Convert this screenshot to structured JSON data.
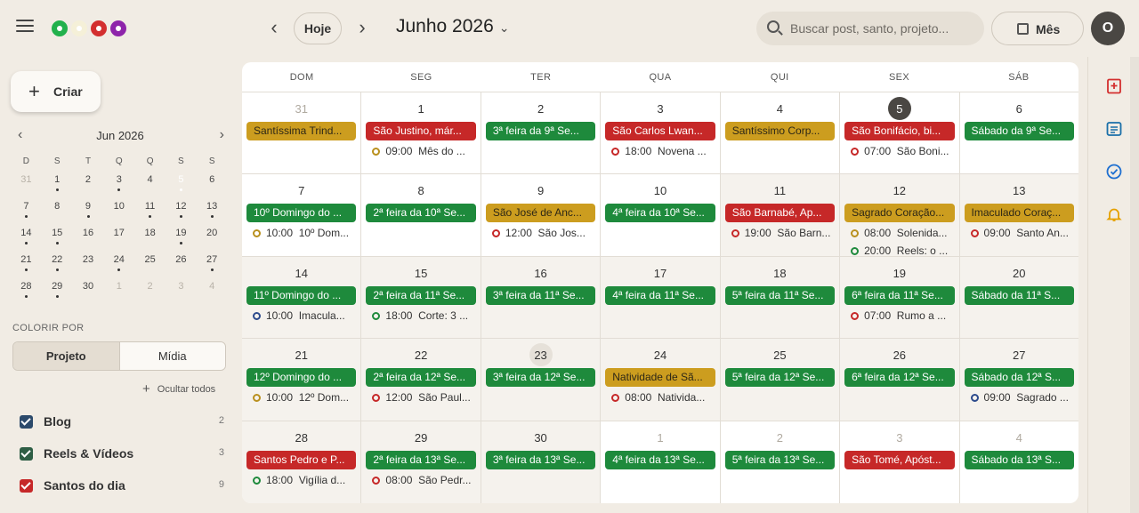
{
  "header": {
    "today_label": "Hoje",
    "month_label": "Junho 2026",
    "search_placeholder": "Buscar post, santo, projeto...",
    "view_label": "Mês",
    "avatar_initial": "O",
    "color_dots": [
      "#22b14c",
      "#f5f0d8",
      "#d32f2f",
      "#8e24aa"
    ]
  },
  "sidebar": {
    "create_label": "Criar",
    "mini_calendar": {
      "title": "Jun 2026",
      "weekdays": [
        "D",
        "S",
        "T",
        "Q",
        "Q",
        "S",
        "S"
      ],
      "weeks": [
        [
          {
            "d": "31",
            "out": true
          },
          {
            "d": "1",
            "dot": true
          },
          {
            "d": "2"
          },
          {
            "d": "3",
            "dot": true
          },
          {
            "d": "4"
          },
          {
            "d": "5",
            "sel": true,
            "dot": true
          },
          {
            "d": "6"
          }
        ],
        [
          {
            "d": "7",
            "dot": true
          },
          {
            "d": "8"
          },
          {
            "d": "9",
            "dot": true
          },
          {
            "d": "10"
          },
          {
            "d": "11",
            "dot": true
          },
          {
            "d": "12",
            "dot": true
          },
          {
            "d": "13",
            "dot": true
          }
        ],
        [
          {
            "d": "14",
            "dot": true
          },
          {
            "d": "15",
            "dot": true
          },
          {
            "d": "16"
          },
          {
            "d": "17"
          },
          {
            "d": "18"
          },
          {
            "d": "19",
            "dot": true
          },
          {
            "d": "20"
          }
        ],
        [
          {
            "d": "21",
            "dot": true
          },
          {
            "d": "22",
            "dot": true
          },
          {
            "d": "23"
          },
          {
            "d": "24",
            "dot": true
          },
          {
            "d": "25"
          },
          {
            "d": "26"
          },
          {
            "d": "27",
            "dot": true
          }
        ],
        [
          {
            "d": "28",
            "dot": true
          },
          {
            "d": "29",
            "dot": true
          },
          {
            "d": "30"
          },
          {
            "d": "1",
            "out": true
          },
          {
            "d": "2",
            "out": true
          },
          {
            "d": "3",
            "out": true
          },
          {
            "d": "4",
            "out": true
          }
        ]
      ]
    },
    "colorir_label": "COLORIR POR",
    "toggle": {
      "projeto": "Projeto",
      "midia": "Mídia"
    },
    "hide_all_label": "Ocultar todos",
    "projects": [
      {
        "name": "Blog",
        "count": "2",
        "color": "#2c4a6b"
      },
      {
        "name": "Reels & Vídeos",
        "count": "3",
        "color": "#2e5e45"
      },
      {
        "name": "Santos do dia",
        "count": "9",
        "color": "#c62828"
      }
    ]
  },
  "calendar": {
    "weekdays": [
      "DOM",
      "SEG",
      "TER",
      "QUA",
      "QUI",
      "SEX",
      "SÁB"
    ],
    "weeks": [
      [
        {
          "d": "31",
          "out": true,
          "past": false,
          "events": [
            {
              "t": "Santíssima Trind...",
              "c": "gold"
            }
          ]
        },
        {
          "d": "1",
          "events": [
            {
              "t": "São Justino, már...",
              "c": "red"
            }
          ],
          "times": [
            {
              "t": "09:00  Mês do ...",
              "c": "gold"
            }
          ]
        },
        {
          "d": "2",
          "events": [
            {
              "t": "3ª feira da 9ª Se...",
              "c": "green"
            }
          ]
        },
        {
          "d": "3",
          "events": [
            {
              "t": "São Carlos Lwan...",
              "c": "red"
            }
          ],
          "times": [
            {
              "t": "18:00  Novena ...",
              "c": "red"
            }
          ]
        },
        {
          "d": "4",
          "events": [
            {
              "t": "Santíssimo Corp...",
              "c": "gold"
            }
          ]
        },
        {
          "d": "5",
          "today": true,
          "events": [
            {
              "t": "São Bonifácio, bi...",
              "c": "red"
            }
          ],
          "times": [
            {
              "t": "07:00  São Boni...",
              "c": "red"
            }
          ]
        },
        {
          "d": "6",
          "events": [
            {
              "t": "Sábado da 9ª Se...",
              "c": "green"
            }
          ]
        }
      ],
      [
        {
          "d": "7",
          "events": [
            {
              "t": "10º Domingo do ...",
              "c": "green"
            }
          ],
          "times": [
            {
              "t": "10:00  10º Dom...",
              "c": "gold"
            }
          ]
        },
        {
          "d": "8",
          "events": [
            {
              "t": "2ª feira da 10ª Se...",
              "c": "green"
            }
          ]
        },
        {
          "d": "9",
          "events": [
            {
              "t": "São José de Anc...",
              "c": "gold"
            }
          ],
          "times": [
            {
              "t": "12:00  São Jos...",
              "c": "red"
            }
          ]
        },
        {
          "d": "10",
          "events": [
            {
              "t": "4ª feira da 10ª Se...",
              "c": "green"
            }
          ]
        },
        {
          "d": "11",
          "past": true,
          "events": [
            {
              "t": "São Barnabé, Ap...",
              "c": "red"
            }
          ],
          "times": [
            {
              "t": "19:00  São Barn...",
              "c": "red"
            }
          ]
        },
        {
          "d": "12",
          "past": true,
          "events": [
            {
              "t": "Sagrado Coração...",
              "c": "gold"
            }
          ],
          "times": [
            {
              "t": "08:00  Solenida...",
              "c": "gold"
            },
            {
              "t": "20:00  Reels: o ...",
              "c": "green"
            }
          ]
        },
        {
          "d": "13",
          "past": true,
          "events": [
            {
              "t": "Imaculado Coraç...",
              "c": "gold"
            }
          ],
          "times": [
            {
              "t": "09:00  Santo An...",
              "c": "red"
            }
          ]
        }
      ],
      [
        {
          "d": "14",
          "past": true,
          "events": [
            {
              "t": "11º Domingo do ...",
              "c": "green"
            }
          ],
          "times": [
            {
              "t": "10:00  Imacula...",
              "c": "blue"
            }
          ]
        },
        {
          "d": "15",
          "past": true,
          "events": [
            {
              "t": "2ª feira da 11ª Se...",
              "c": "green"
            }
          ],
          "times": [
            {
              "t": "18:00  Corte: 3 ...",
              "c": "green"
            }
          ]
        },
        {
          "d": "16",
          "past": true,
          "events": [
            {
              "t": "3ª feira da 11ª Se...",
              "c": "green"
            }
          ]
        },
        {
          "d": "17",
          "past": true,
          "events": [
            {
              "t": "4ª feira da 11ª Se...",
              "c": "green"
            }
          ]
        },
        {
          "d": "18",
          "past": true,
          "events": [
            {
              "t": "5ª feira da 11ª Se...",
              "c": "green"
            }
          ]
        },
        {
          "d": "19",
          "past": true,
          "events": [
            {
              "t": "6ª feira da 11ª Se...",
              "c": "green"
            }
          ],
          "times": [
            {
              "t": "07:00  Rumo a ...",
              "c": "red"
            }
          ]
        },
        {
          "d": "20",
          "past": true,
          "events": [
            {
              "t": "Sábado da 11ª S...",
              "c": "green"
            }
          ]
        }
      ],
      [
        {
          "d": "21",
          "past": true,
          "events": [
            {
              "t": "12º Domingo do ...",
              "c": "green"
            }
          ],
          "times": [
            {
              "t": "10:00  12º Dom...",
              "c": "gold"
            }
          ]
        },
        {
          "d": "22",
          "past": true,
          "events": [
            {
              "t": "2ª feira da 12ª Se...",
              "c": "green"
            }
          ],
          "times": [
            {
              "t": "12:00  São Paul...",
              "c": "red"
            }
          ]
        },
        {
          "d": "23",
          "past": true,
          "hl": true,
          "events": [
            {
              "t": "3ª feira da 12ª Se...",
              "c": "green"
            }
          ]
        },
        {
          "d": "24",
          "past": true,
          "events": [
            {
              "t": "Natividade de Sã...",
              "c": "gold"
            }
          ],
          "times": [
            {
              "t": "08:00  Nativida...",
              "c": "red"
            }
          ]
        },
        {
          "d": "25",
          "past": true,
          "events": [
            {
              "t": "5ª feira da 12ª Se...",
              "c": "green"
            }
          ]
        },
        {
          "d": "26",
          "past": true,
          "events": [
            {
              "t": "6ª feira da 12ª Se...",
              "c": "green"
            }
          ]
        },
        {
          "d": "27",
          "past": true,
          "events": [
            {
              "t": "Sábado da 12ª S...",
              "c": "green"
            }
          ],
          "times": [
            {
              "t": "09:00  Sagrado ...",
              "c": "blue"
            }
          ]
        }
      ],
      [
        {
          "d": "28",
          "past": true,
          "events": [
            {
              "t": "Santos Pedro e P...",
              "c": "red"
            }
          ],
          "times": [
            {
              "t": "18:00  Vigília d...",
              "c": "green"
            }
          ]
        },
        {
          "d": "29",
          "past": true,
          "events": [
            {
              "t": "2ª feira da 13ª Se...",
              "c": "green"
            }
          ],
          "times": [
            {
              "t": "08:00  São Pedr...",
              "c": "red"
            }
          ]
        },
        {
          "d": "30",
          "past": true,
          "events": [
            {
              "t": "3ª feira da 13ª Se...",
              "c": "green"
            }
          ]
        },
        {
          "d": "1",
          "out": true,
          "events": [
            {
              "t": "4ª feira da 13ª Se...",
              "c": "green"
            }
          ]
        },
        {
          "d": "2",
          "out": true,
          "events": [
            {
              "t": "5ª feira da 13ª Se...",
              "c": "green"
            }
          ]
        },
        {
          "d": "3",
          "out": true,
          "events": [
            {
              "t": "São Tomé, Apóst...",
              "c": "red"
            }
          ]
        },
        {
          "d": "4",
          "out": true,
          "events": [
            {
              "t": "Sábado da 13ª S...",
              "c": "green"
            }
          ]
        }
      ]
    ]
  },
  "right_rail": {
    "icons": [
      {
        "name": "add-note-icon",
        "color": "#d32f2f"
      },
      {
        "name": "notes-icon",
        "color": "#1a6fa8"
      },
      {
        "name": "tasks-icon",
        "color": "#1e6fd0"
      },
      {
        "name": "bell-icon",
        "color": "#e5a000"
      }
    ]
  }
}
